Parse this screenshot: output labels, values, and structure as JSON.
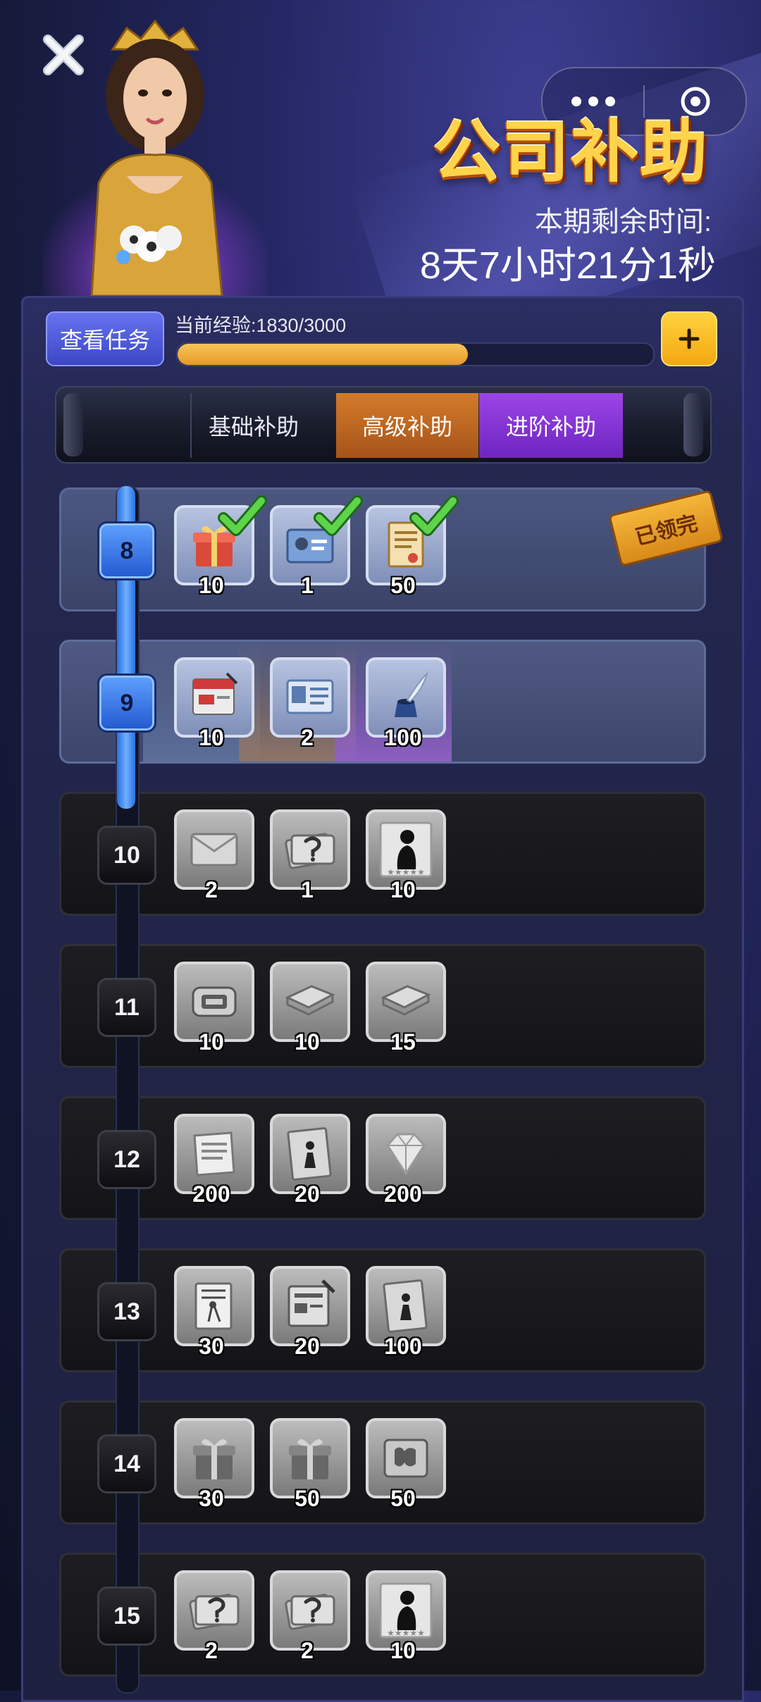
{
  "header": {
    "title": "公司补助",
    "timer_label": "本期剩余时间:",
    "timer_value": "8天7小时21分1秒"
  },
  "experience": {
    "task_button": "查看任务",
    "label": "当前经验:1830/3000",
    "current": 1830,
    "max": 3000
  },
  "tabs": [
    "基础补助",
    "高级补助",
    "进阶补助"
  ],
  "stamp_text": "已领完",
  "colors": {
    "accent_blue": "#3a72e8",
    "tab_advanced": "#c06a22",
    "tab_pro": "#8a36d8",
    "title_gold": "#ffd34a"
  },
  "levels": [
    {
      "level": "8",
      "state": "claimed",
      "items": [
        {
          "icon": "gift-box-icon",
          "qty": "10",
          "checked": true
        },
        {
          "icon": "id-card-icon",
          "qty": "1",
          "checked": true
        },
        {
          "icon": "contract-scroll-icon",
          "qty": "50",
          "checked": true
        }
      ]
    },
    {
      "level": "9",
      "state": "active",
      "items": [
        {
          "icon": "red-document-icon",
          "qty": "10"
        },
        {
          "icon": "resume-card-icon",
          "qty": "2"
        },
        {
          "icon": "ink-quill-icon",
          "qty": "100"
        }
      ]
    },
    {
      "level": "10",
      "state": "locked",
      "items": [
        {
          "icon": "envelope-card-icon",
          "qty": "2"
        },
        {
          "icon": "mystery-card-icon",
          "qty": "1"
        },
        {
          "icon": "character-silhouette-icon",
          "qty": "10"
        }
      ]
    },
    {
      "level": "11",
      "state": "locked",
      "items": [
        {
          "icon": "badge-tag-icon",
          "qty": "10"
        },
        {
          "icon": "book-icon",
          "qty": "10"
        },
        {
          "icon": "book-icon",
          "qty": "15"
        }
      ]
    },
    {
      "level": "12",
      "state": "locked",
      "items": [
        {
          "icon": "paper-sheet-icon",
          "qty": "200"
        },
        {
          "icon": "photo-frame-icon",
          "qty": "20"
        },
        {
          "icon": "diamond-icon",
          "qty": "200"
        }
      ]
    },
    {
      "level": "13",
      "state": "locked",
      "items": [
        {
          "icon": "blueprint-icon",
          "qty": "30"
        },
        {
          "icon": "clipboard-pen-icon",
          "qty": "20"
        },
        {
          "icon": "photo-frame-icon",
          "qty": "100"
        }
      ]
    },
    {
      "level": "14",
      "state": "locked",
      "items": [
        {
          "icon": "gift-box-icon",
          "qty": "30"
        },
        {
          "icon": "gift-box-icon",
          "qty": "50"
        },
        {
          "icon": "puzzle-box-icon",
          "qty": "50"
        }
      ]
    },
    {
      "level": "15",
      "state": "locked",
      "items": [
        {
          "icon": "mystery-card-icon",
          "qty": "2"
        },
        {
          "icon": "mystery-card-icon",
          "qty": "2"
        },
        {
          "icon": "character-silhouette-icon",
          "qty": "10"
        }
      ]
    }
  ]
}
